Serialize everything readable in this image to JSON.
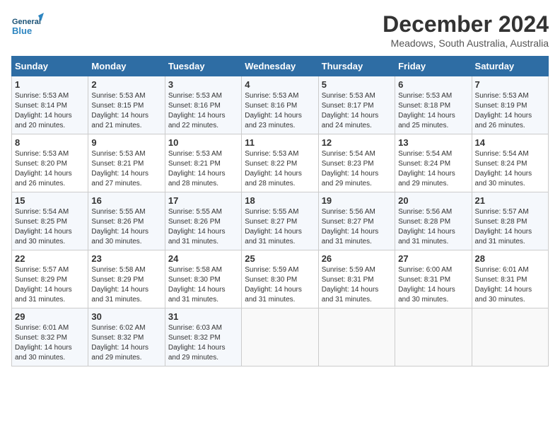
{
  "header": {
    "logo_general": "General",
    "logo_blue": "Blue",
    "month": "December 2024",
    "location": "Meadows, South Australia, Australia"
  },
  "calendar": {
    "weekdays": [
      "Sunday",
      "Monday",
      "Tuesday",
      "Wednesday",
      "Thursday",
      "Friday",
      "Saturday"
    ],
    "weeks": [
      [
        {
          "day": "",
          "info": ""
        },
        {
          "day": "",
          "info": ""
        },
        {
          "day": "",
          "info": ""
        },
        {
          "day": "",
          "info": ""
        },
        {
          "day": "5",
          "info": "Sunrise: 5:53 AM\nSunset: 8:17 PM\nDaylight: 14 hours\nand 24 minutes."
        },
        {
          "day": "6",
          "info": "Sunrise: 5:53 AM\nSunset: 8:18 PM\nDaylight: 14 hours\nand 25 minutes."
        },
        {
          "day": "7",
          "info": "Sunrise: 5:53 AM\nSunset: 8:19 PM\nDaylight: 14 hours\nand 26 minutes."
        }
      ],
      [
        {
          "day": "1",
          "info": "Sunrise: 5:53 AM\nSunset: 8:14 PM\nDaylight: 14 hours\nand 20 minutes."
        },
        {
          "day": "2",
          "info": "Sunrise: 5:53 AM\nSunset: 8:15 PM\nDaylight: 14 hours\nand 21 minutes."
        },
        {
          "day": "3",
          "info": "Sunrise: 5:53 AM\nSunset: 8:16 PM\nDaylight: 14 hours\nand 22 minutes."
        },
        {
          "day": "4",
          "info": "Sunrise: 5:53 AM\nSunset: 8:16 PM\nDaylight: 14 hours\nand 23 minutes."
        },
        {
          "day": "5",
          "info": "Sunrise: 5:53 AM\nSunset: 8:17 PM\nDaylight: 14 hours\nand 24 minutes."
        },
        {
          "day": "6",
          "info": "Sunrise: 5:53 AM\nSunset: 8:18 PM\nDaylight: 14 hours\nand 25 minutes."
        },
        {
          "day": "7",
          "info": "Sunrise: 5:53 AM\nSunset: 8:19 PM\nDaylight: 14 hours\nand 26 minutes."
        }
      ],
      [
        {
          "day": "8",
          "info": "Sunrise: 5:53 AM\nSunset: 8:20 PM\nDaylight: 14 hours\nand 26 minutes."
        },
        {
          "day": "9",
          "info": "Sunrise: 5:53 AM\nSunset: 8:21 PM\nDaylight: 14 hours\nand 27 minutes."
        },
        {
          "day": "10",
          "info": "Sunrise: 5:53 AM\nSunset: 8:21 PM\nDaylight: 14 hours\nand 28 minutes."
        },
        {
          "day": "11",
          "info": "Sunrise: 5:53 AM\nSunset: 8:22 PM\nDaylight: 14 hours\nand 28 minutes."
        },
        {
          "day": "12",
          "info": "Sunrise: 5:54 AM\nSunset: 8:23 PM\nDaylight: 14 hours\nand 29 minutes."
        },
        {
          "day": "13",
          "info": "Sunrise: 5:54 AM\nSunset: 8:24 PM\nDaylight: 14 hours\nand 29 minutes."
        },
        {
          "day": "14",
          "info": "Sunrise: 5:54 AM\nSunset: 8:24 PM\nDaylight: 14 hours\nand 30 minutes."
        }
      ],
      [
        {
          "day": "15",
          "info": "Sunrise: 5:54 AM\nSunset: 8:25 PM\nDaylight: 14 hours\nand 30 minutes."
        },
        {
          "day": "16",
          "info": "Sunrise: 5:55 AM\nSunset: 8:26 PM\nDaylight: 14 hours\nand 30 minutes."
        },
        {
          "day": "17",
          "info": "Sunrise: 5:55 AM\nSunset: 8:26 PM\nDaylight: 14 hours\nand 31 minutes."
        },
        {
          "day": "18",
          "info": "Sunrise: 5:55 AM\nSunset: 8:27 PM\nDaylight: 14 hours\nand 31 minutes."
        },
        {
          "day": "19",
          "info": "Sunrise: 5:56 AM\nSunset: 8:27 PM\nDaylight: 14 hours\nand 31 minutes."
        },
        {
          "day": "20",
          "info": "Sunrise: 5:56 AM\nSunset: 8:28 PM\nDaylight: 14 hours\nand 31 minutes."
        },
        {
          "day": "21",
          "info": "Sunrise: 5:57 AM\nSunset: 8:28 PM\nDaylight: 14 hours\nand 31 minutes."
        }
      ],
      [
        {
          "day": "22",
          "info": "Sunrise: 5:57 AM\nSunset: 8:29 PM\nDaylight: 14 hours\nand 31 minutes."
        },
        {
          "day": "23",
          "info": "Sunrise: 5:58 AM\nSunset: 8:29 PM\nDaylight: 14 hours\nand 31 minutes."
        },
        {
          "day": "24",
          "info": "Sunrise: 5:58 AM\nSunset: 8:30 PM\nDaylight: 14 hours\nand 31 minutes."
        },
        {
          "day": "25",
          "info": "Sunrise: 5:59 AM\nSunset: 8:30 PM\nDaylight: 14 hours\nand 31 minutes."
        },
        {
          "day": "26",
          "info": "Sunrise: 5:59 AM\nSunset: 8:31 PM\nDaylight: 14 hours\nand 31 minutes."
        },
        {
          "day": "27",
          "info": "Sunrise: 6:00 AM\nSunset: 8:31 PM\nDaylight: 14 hours\nand 30 minutes."
        },
        {
          "day": "28",
          "info": "Sunrise: 6:01 AM\nSunset: 8:31 PM\nDaylight: 14 hours\nand 30 minutes."
        }
      ],
      [
        {
          "day": "29",
          "info": "Sunrise: 6:01 AM\nSunset: 8:32 PM\nDaylight: 14 hours\nand 30 minutes."
        },
        {
          "day": "30",
          "info": "Sunrise: 6:02 AM\nSunset: 8:32 PM\nDaylight: 14 hours\nand 29 minutes."
        },
        {
          "day": "31",
          "info": "Sunrise: 6:03 AM\nSunset: 8:32 PM\nDaylight: 14 hours\nand 29 minutes."
        },
        {
          "day": "",
          "info": ""
        },
        {
          "day": "",
          "info": ""
        },
        {
          "day": "",
          "info": ""
        },
        {
          "day": "",
          "info": ""
        }
      ]
    ]
  }
}
